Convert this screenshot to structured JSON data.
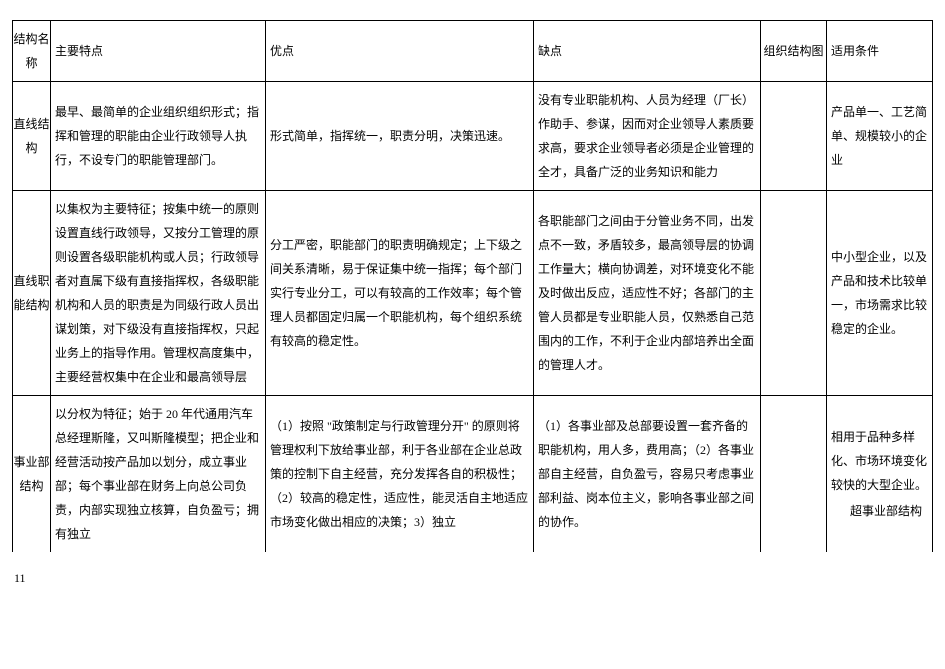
{
  "table": {
    "header": {
      "c1": "结构名称",
      "c2": "主要特点",
      "c3": "优点",
      "c4": "缺点",
      "c5": "组织结构图",
      "c6": "适用条件"
    },
    "rows": [
      {
        "c1": "直线结构",
        "c2": "最早、最简单的企业组织组织形式；指挥和管理的职能由企业行政领导人执行，不设专门的职能管理部门。",
        "c3": "形式简单，指挥统一，职责分明，决策迅速。",
        "c4": "没有专业职能机构、人员为经理（厂长）作助手、参谋，因而对企业领导人素质要求高，要求企业领导者必须是企业管理的全才，具备广泛的业务知识和能力",
        "c5": "",
        "c6": "产品单一、工艺简单、规模较小的企业"
      },
      {
        "c1": "直线职能结构",
        "c2": "以集权为主要特征；按集中统一的原则设置直线行政领导，又按分工管理的原则设置各级职能机构或人员；行政领导者对直属下级有直接指挥权，各级职能机构和人员的职责是为同级行政人员出谋划策，对下级没有直接指挥权，只起业务上的指导作用。管理权高度集中，主要经营权集中在企业和最高领导层",
        "c3": "分工严密，职能部门的职责明确规定；上下级之间关系清晰，易于保证集中统一指挥；每个部门实行专业分工，可以有较高的工作效率；每个管理人员都固定归属一个职能机构，每个组织系统有较高的稳定性。",
        "c4": "各职能部门之间由于分管业务不同，出发点不一致，矛盾较多，最高领导层的协调工作量大；横向协调差，对环境变化不能及时做出反应，适应性不好；各部门的主管人员都是专业职能人员，仅熟悉自己范围内的工作，不利于企业内部培养出全面的管理人才。",
        "c5": "",
        "c6": "中小型企业，以及产品和技术比较单一，市场需求比较稳定的企业。"
      },
      {
        "c1": "事业部结构",
        "c2": "以分权为特征；始于 20 年代通用汽车总经理斯隆，又叫斯隆模型；把企业和经营活动按产品加以划分，成立事业部；每个事业部在财务上向总公司负责，内部实现独立核算，自负盈亏；拥有独立",
        "c3": "（1）按照 \"政策制定与行政管理分开\" 的原则将管理权利下放给事业部，利于各业部在企业总政策的控制下自主经营，充分发挥各自的积极性；（2）较高的稳定性，适应性，能灵活自主地适应市场变化做出相应的决策；3）独立",
        "c4": "（1）各事业部及总部要设置一套齐备的职能机构，用人多，费用高；（2）各事业部自主经营，自负盈亏，容易只考虑事业部利益、岗本位主义，影响各事业部之间的协作。",
        "c5": "",
        "c6": "相用于品种多样化、市场环境变化较快的大型企业。",
        "c6_note": "超事业部结构"
      }
    ]
  },
  "page_number": "11"
}
